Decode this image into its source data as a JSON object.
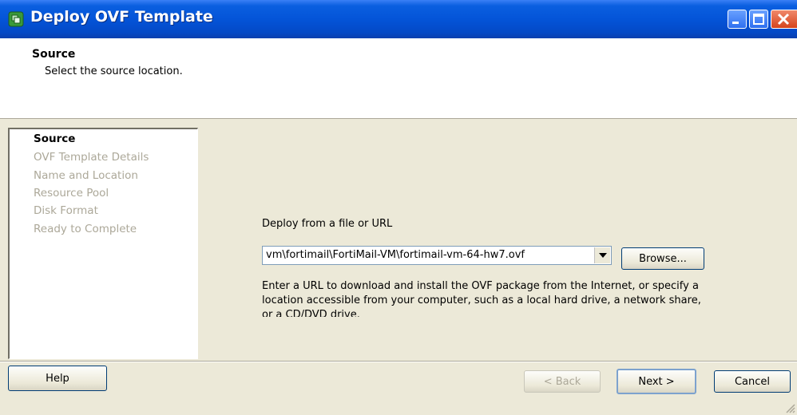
{
  "window": {
    "title": "Deploy OVF Template",
    "icon": "vsphere-deploy-icon",
    "controls": [
      "minimize-icon",
      "maximize-icon",
      "close-icon"
    ]
  },
  "header": {
    "title": "Source",
    "subtitle": "Select the source location."
  },
  "nav": {
    "items": [
      {
        "label": "Source",
        "active": true
      },
      {
        "label": "OVF Template Details",
        "active": false
      },
      {
        "label": "Name and Location",
        "active": false
      },
      {
        "label": "Resource Pool",
        "active": false
      },
      {
        "label": "Disk Format",
        "active": false
      },
      {
        "label": "Ready to Complete",
        "active": false
      }
    ]
  },
  "main": {
    "deploy_label": "Deploy from a file or URL",
    "source_value": "vm\\fortimail\\FortiMail-VM\\fortimail-vm-64-hw7.ovf",
    "browse_label": "Browse...",
    "help_text": "Enter a URL to download and install the OVF package from the Internet, or specify a location accessible from your computer, such as a local hard drive, a network share, or a CD/DVD drive."
  },
  "footer": {
    "help_label": "Help",
    "back_label": "< Back",
    "next_label": "Next >",
    "cancel_label": "Cancel"
  },
  "colors": {
    "titlebar": "#0454d8",
    "face": "#ece9d8",
    "disabled_text": "#aca899"
  }
}
